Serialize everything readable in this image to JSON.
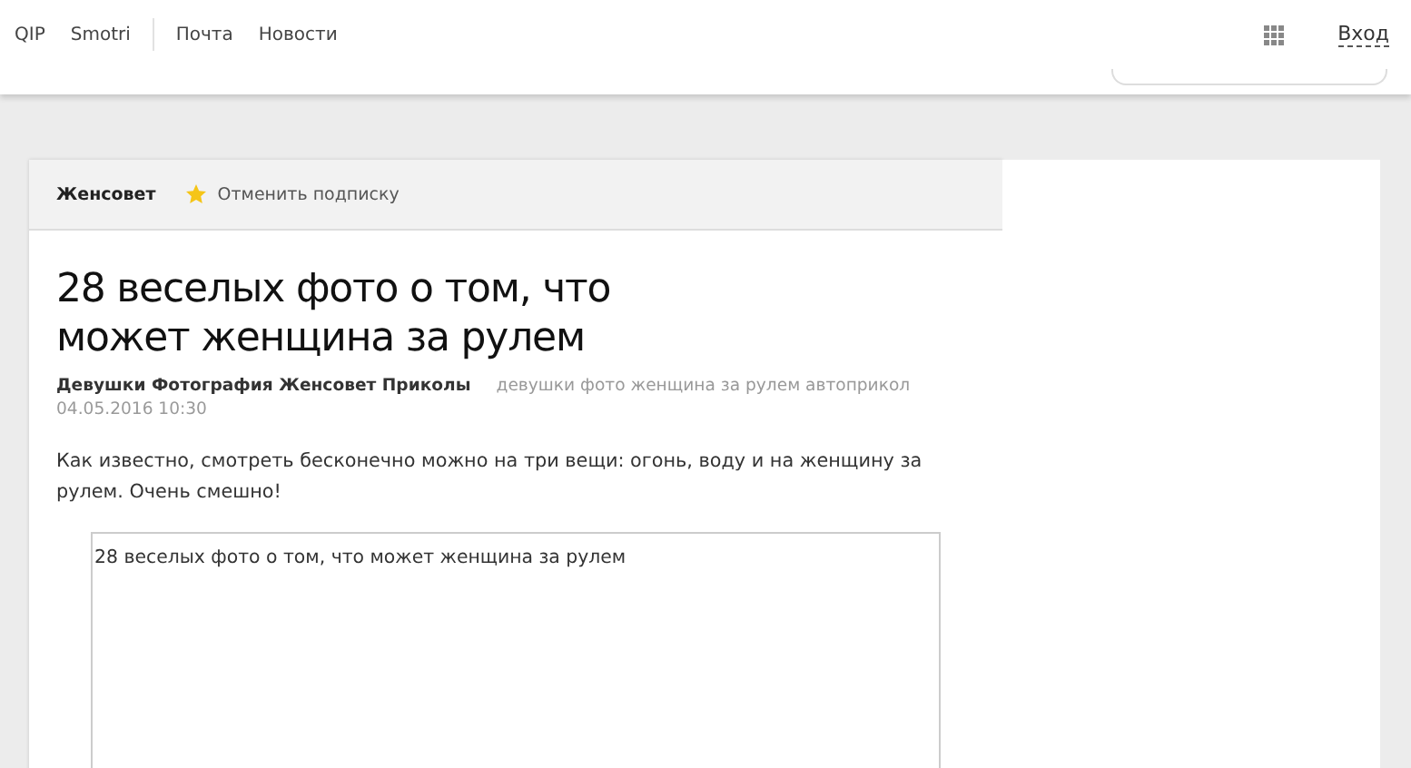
{
  "top_bar": {
    "left_links": [
      "QIP",
      "Smotri"
    ],
    "service_links": [
      "Почта",
      "Новости"
    ],
    "login": "Вход"
  },
  "channel_bar": {
    "name": "Женсовет",
    "unsubscribe": "Отменить подписку"
  },
  "article": {
    "title": "28 веселых фото о том, что может женщина за рулем",
    "categories": "Девушки Фотография Женсовет Приколы",
    "tags": "девушки фото женщина за рулем автоприкол",
    "date": "04.05.2016 10:30",
    "lead": "Как известно, смотреть бесконечно можно на три вещи: огонь, воду и на женщину за рулем. Очень смешно!",
    "embed": {
      "title": "28 веселых фото о том, что может женщина за рулем"
    }
  }
}
